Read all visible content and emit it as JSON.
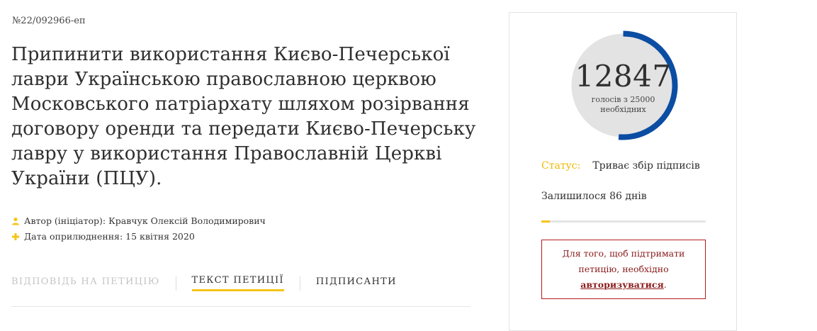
{
  "petition": {
    "number": "№22/092966-еп",
    "title": "Припинити використання Києво-Печерської лаври Українською православною церквою Московського патріархату шляхом розірвання договору оренди та передати Києво-Печерську лавру у використання Православній Церкві України (ПЦУ).",
    "author": "Автор (ініціатор): Кравчук Олексій Володимирович",
    "published": "Дата оприлюднення: 15 квітня 2020"
  },
  "tabs": [
    {
      "label": "Відповідь на петицію",
      "state": "disabled"
    },
    {
      "label": "Текст петиції",
      "state": "active"
    },
    {
      "label": "Підписанти",
      "state": "normal"
    }
  ],
  "votes": {
    "count": "12847",
    "caption_line1": "голосів з 25000",
    "caption_line2": "необхідних",
    "progress_fraction": 0.51388
  },
  "status": {
    "label": "Статус:",
    "value": "Триває збір підписів"
  },
  "remaining": "Залишилося 86 днів",
  "time_progress_fraction": 0.05,
  "notice": {
    "text_before": "Для того, щоб підтримати петицію, необхідно",
    "link_text": "авторизуватися",
    "text_after": "."
  },
  "colors": {
    "accent_yellow": "#f5c518",
    "ring_blue": "#0b4da2",
    "ring_grey": "#e6e6e6",
    "notice_red": "#b31b1b"
  }
}
